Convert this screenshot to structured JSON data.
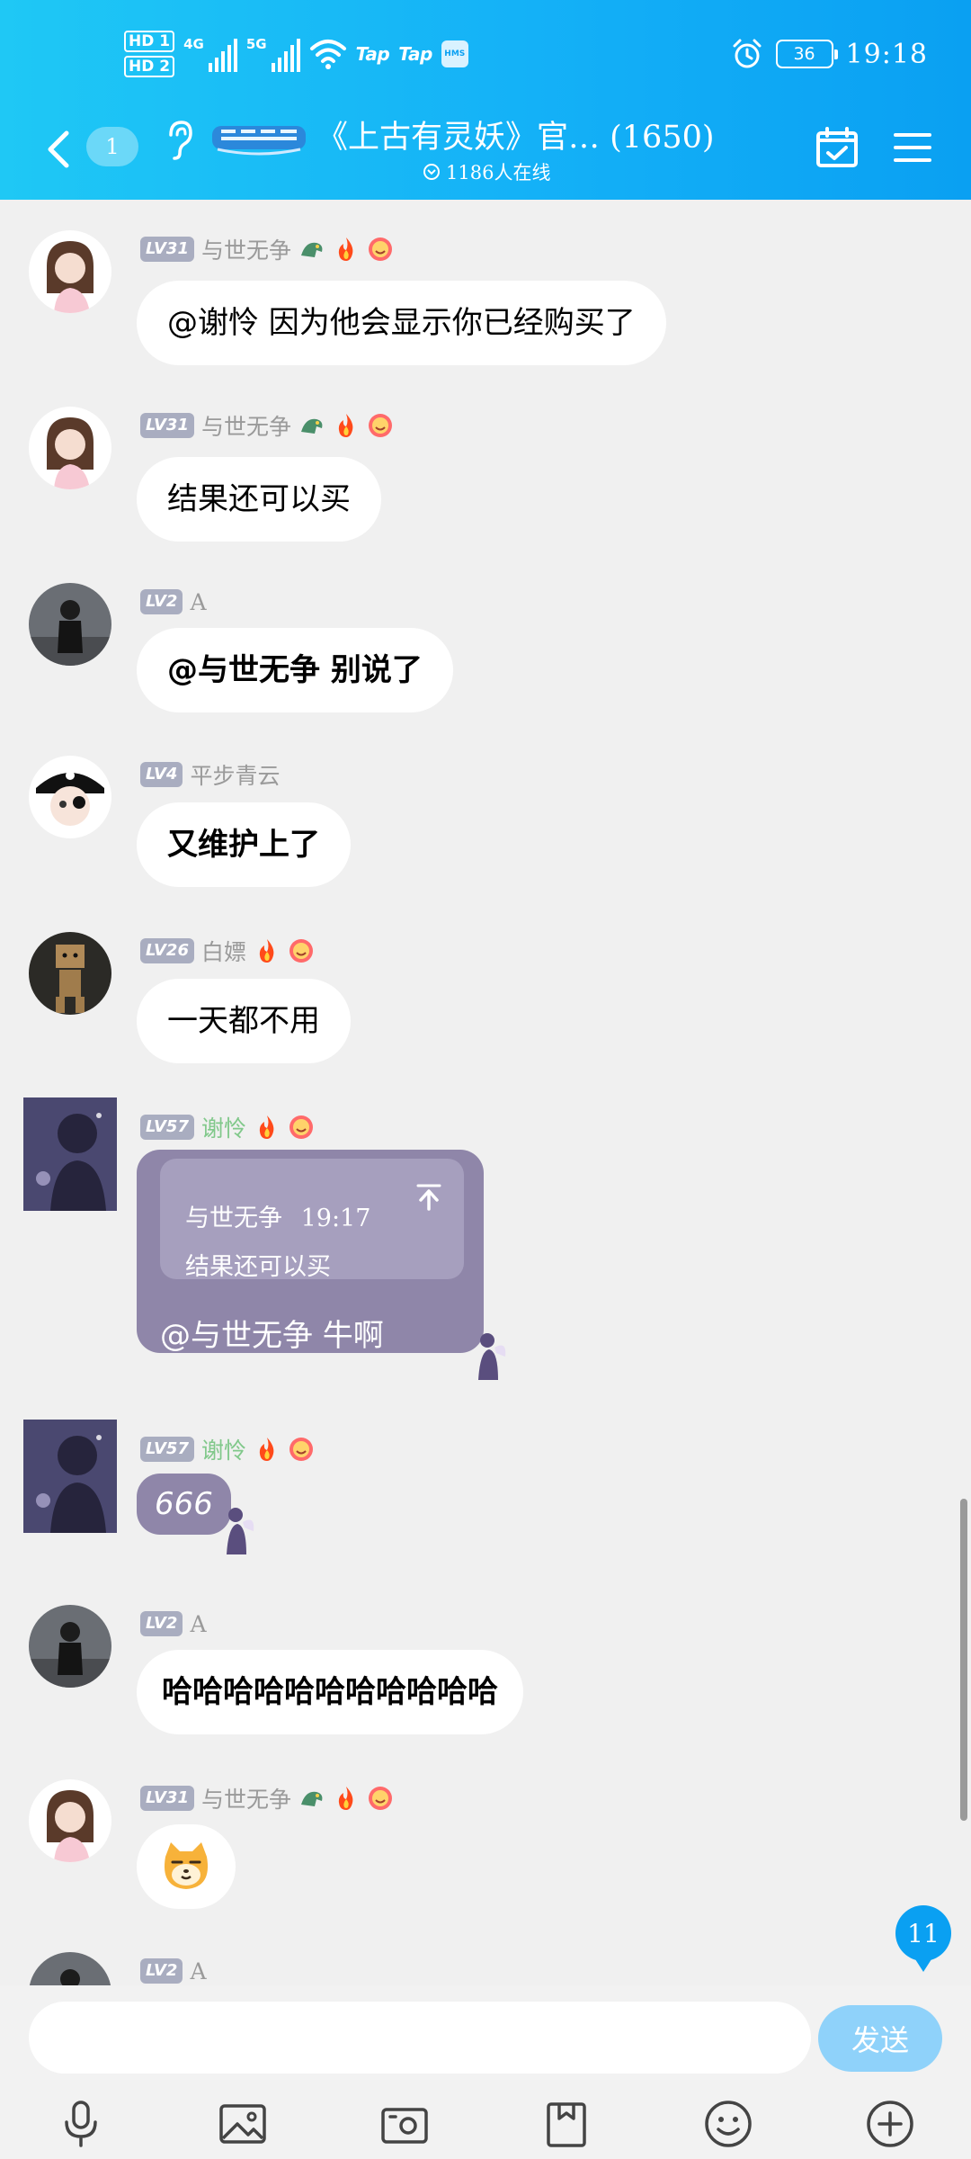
{
  "status_bar": {
    "hd1": "HD 1",
    "hd2": "HD 2",
    "net1": "4G",
    "net2": "5G",
    "app1": "Tap",
    "app2": "Tap",
    "hms": "HMS",
    "battery": "36",
    "time": "19:18"
  },
  "header": {
    "unread_count": "1",
    "title": "《上古有灵妖》官… (1650)",
    "online": "1186人在线",
    "accent_color": "#14b1f7",
    "icons": [
      "back-arrow-icon",
      "ear-icon",
      "group-logo",
      "calendar-check-icon",
      "menu-icon"
    ]
  },
  "messages": [
    {
      "level": "LV31",
      "name": "与世无争",
      "text": "@谢怜 因为他会显示你已经购买了"
    },
    {
      "level": "LV31",
      "name": "与世无争",
      "text": "结果还可以买"
    },
    {
      "level": "LV2",
      "name": "A",
      "text": "@与世无争 别说了"
    },
    {
      "level": "LV4",
      "name": "平步青云",
      "text": "又维护上了"
    },
    {
      "level": "LV26",
      "name": "白嫖",
      "text": "一天都不用"
    },
    {
      "level": "LV57",
      "name": "谢怜",
      "quote_author": "与世无争",
      "quote_time": "19:17",
      "quote_text": "结果还可以买",
      "text": "@与世无争 牛啊"
    },
    {
      "level": "LV57",
      "name": "谢怜",
      "text": "666"
    },
    {
      "level": "LV2",
      "name": "A",
      "text": "哈哈哈哈哈哈哈哈哈哈哈"
    },
    {
      "level": "LV31",
      "name": "与世无争",
      "emoji": "cat-face-emoji"
    },
    {
      "level": "LV2",
      "name": "A"
    }
  ],
  "new_message_count": "11",
  "composer": {
    "placeholder": "",
    "send_label": "发送",
    "tools": [
      "microphone-icon",
      "image-icon",
      "camera-icon",
      "file-icon",
      "emoji-icon",
      "plus-icon"
    ]
  }
}
